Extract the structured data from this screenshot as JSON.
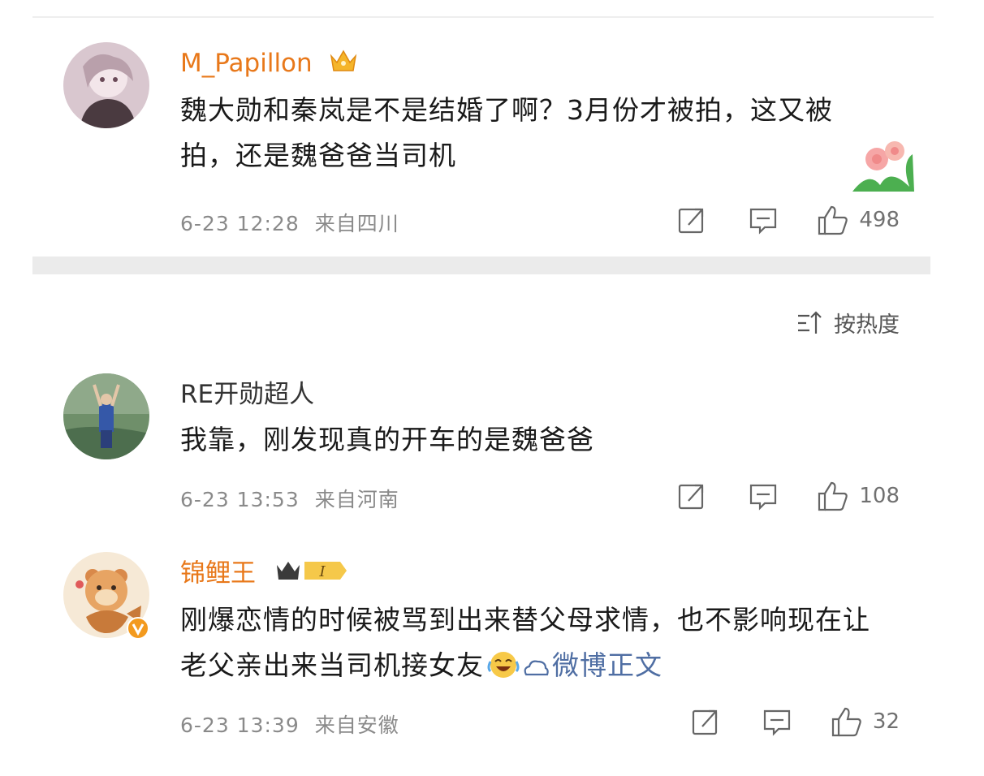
{
  "comments": [
    {
      "username": "M_Papillon",
      "text": "魏大勋和秦岚是不是结婚了啊？3月份才被拍，这又被拍，还是魏爸爸当司机",
      "time": "6-23 12:28",
      "location": "来自四川",
      "likes": "498"
    },
    {
      "username": "RE开勋超人",
      "text": "我靠，刚发现真的开车的是魏爸爸",
      "time": "6-23 13:53",
      "location": "来自河南",
      "likes": "108"
    },
    {
      "username": "锦鲤王",
      "text": "刚爆恋情的时候被骂到出来替父母求情，也不影响现在让老父亲出来当司机接女友",
      "link_text": "微博正文",
      "time": "6-23 13:39",
      "location": "来自安徽",
      "likes": "32",
      "badge_label": "I"
    }
  ],
  "sort": {
    "label": "按热度"
  },
  "colors": {
    "username_vip": "#e8781a",
    "link": "#4f6ea3",
    "meta": "#8a8a8a"
  },
  "icons": [
    "crown-icon",
    "share-icon",
    "comment-icon",
    "like-icon",
    "sort-icon",
    "flower-emoji-icon",
    "laugh-cry-emoji-icon",
    "weibo-link-icon",
    "verified-v-icon"
  ]
}
